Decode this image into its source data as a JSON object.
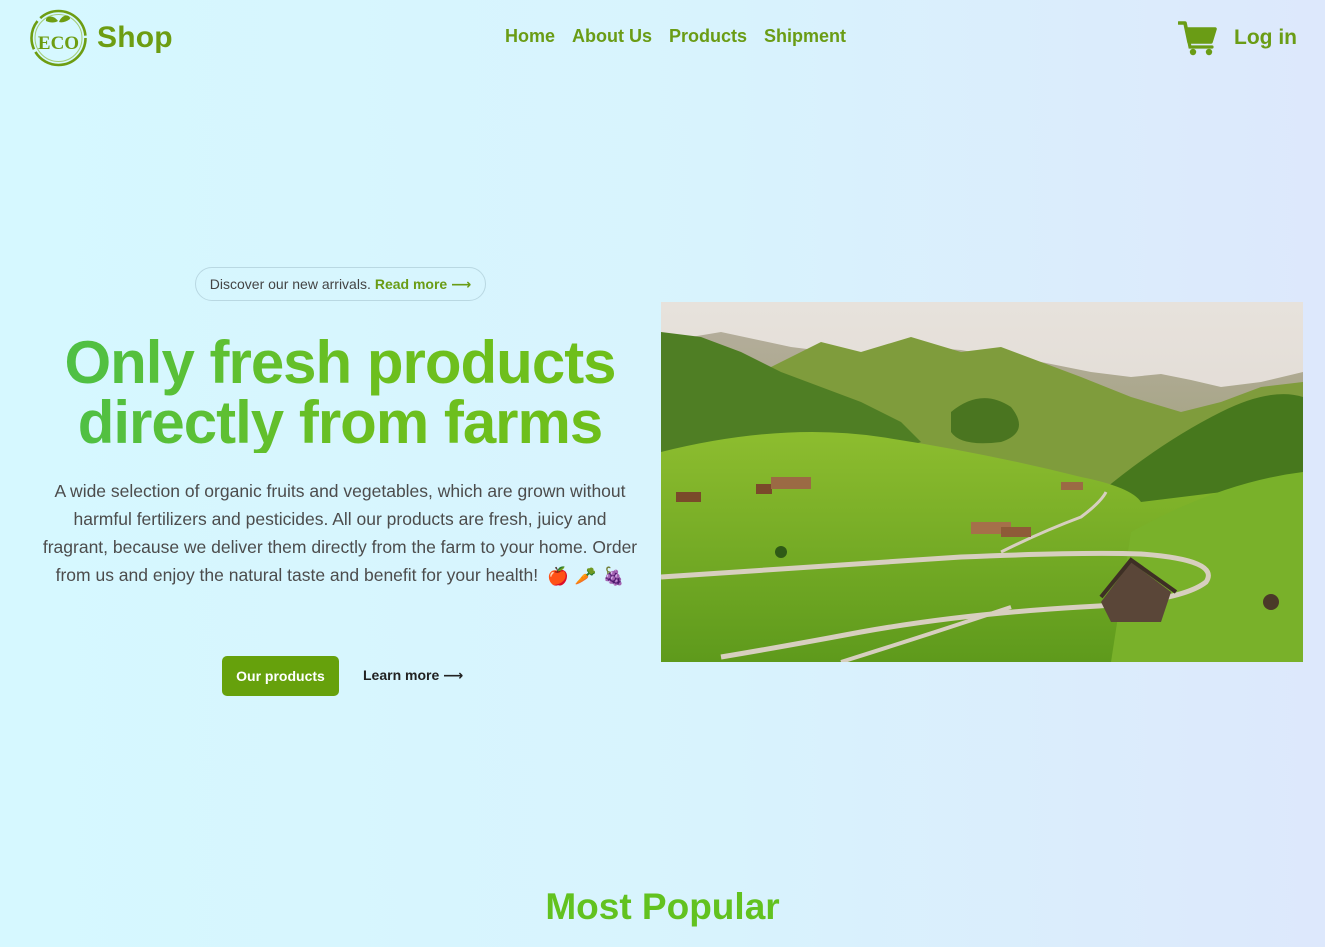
{
  "brand": {
    "logo_text": "ECO",
    "name": "Shop",
    "color": "#6d9d12"
  },
  "nav": {
    "items": [
      "Home",
      "About Us",
      "Products",
      "Shipment"
    ]
  },
  "header": {
    "cart_icon": "shopping-cart-icon",
    "login_label": "Log in"
  },
  "announcement": {
    "text": "Discover our new arrivals.",
    "link_label": "Read more ⟶"
  },
  "hero": {
    "title_line1": "Only fresh products",
    "title_line2": "directly from farms",
    "description": "A wide selection of organic fruits and vegetables, which are grown without harmful fertilizers and pesticides. All our products are fresh, juicy and fragrant, because we deliver them directly from the farm to your home. Order from us and enjoy the natural taste and benefit for your health!",
    "emojis": [
      "🍎",
      "🥕",
      "🍇"
    ],
    "primary_button": "Our products",
    "secondary_link": "Learn more ⟶",
    "image_subject": "green-valley-landscape"
  },
  "sections": {
    "most_popular_title": "Most Popular"
  },
  "colors": {
    "accent": "#66a10c",
    "title_gradient_start": "#4bc04a",
    "title_gradient_end": "#6fbf19"
  }
}
